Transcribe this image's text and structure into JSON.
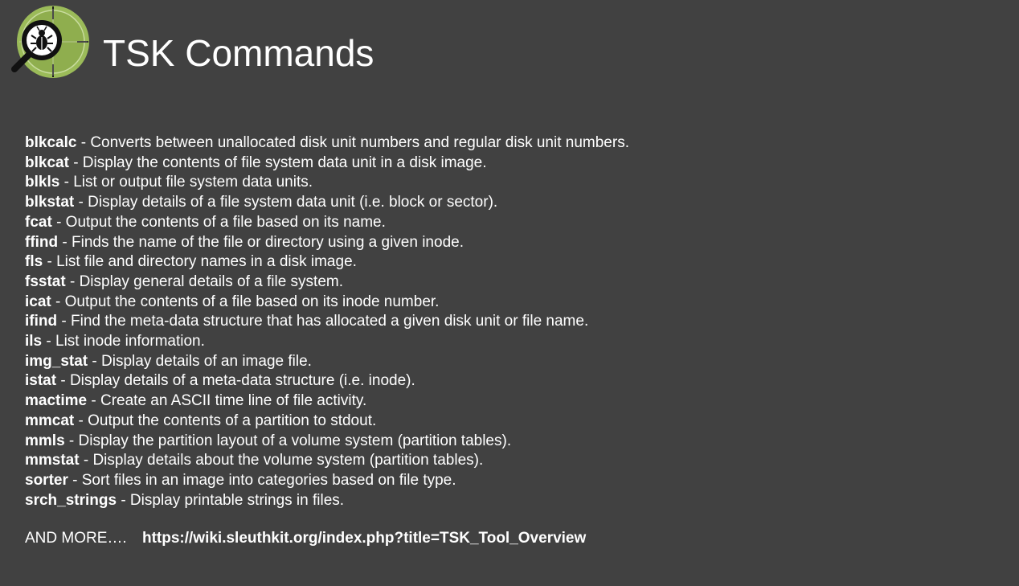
{
  "title": "TSK Commands",
  "logo": {
    "icon": "magnifier-bug-icon",
    "ring_color": "#9bbb59",
    "fill_color": "#8fae4e"
  },
  "commands": [
    {
      "name": "blkcalc",
      "desc": " - Converts between unallocated disk unit numbers and regular disk unit numbers."
    },
    {
      "name": "blkcat",
      "desc": " - Display the contents of file system data unit in a disk image."
    },
    {
      "name": "blkls",
      "desc": " - List or output file system data units."
    },
    {
      "name": "blkstat",
      "desc": " - Display details of a file system data unit (i.e. block or sector)."
    },
    {
      "name": "fcat",
      "desc": " - Output the contents of a file based on its name."
    },
    {
      "name": "ffind",
      "desc": " - Finds the name of the file or directory using a given inode."
    },
    {
      "name": "fls",
      "desc": " - List file and directory names in a disk image."
    },
    {
      "name": "fsstat",
      "desc": " - Display general details of a file system."
    },
    {
      "name": "icat",
      "desc": " - Output the contents of a file based on its inode number."
    },
    {
      "name": "ifind",
      "desc": " - Find the meta-data structure that has allocated a given disk unit or file name."
    },
    {
      "name": "ils",
      "desc": " - List inode information."
    },
    {
      "name": "img_stat",
      "desc": " - Display details of an image file."
    },
    {
      "name": "istat",
      "desc": " - Display details of a meta-data structure (i.e. inode)."
    },
    {
      "name": "mactime",
      "desc": " - Create an ASCII time line of file activity."
    },
    {
      "name": "mmcat",
      "desc": " - Output the contents of a partition to stdout."
    },
    {
      "name": "mmls",
      "desc": " - Display the partition layout of a volume system (partition tables)."
    },
    {
      "name": "mmstat",
      "desc": " - Display details about the volume system (partition tables)."
    },
    {
      "name": "sorter",
      "desc": " - Sort files in an image into categories based on file type."
    },
    {
      "name": "srch_strings",
      "desc": " - Display printable strings in files."
    }
  ],
  "footer": {
    "more_label": "AND MORE….",
    "link": "https://wiki.sleuthkit.org/index.php?title=TSK_Tool_Overview"
  }
}
